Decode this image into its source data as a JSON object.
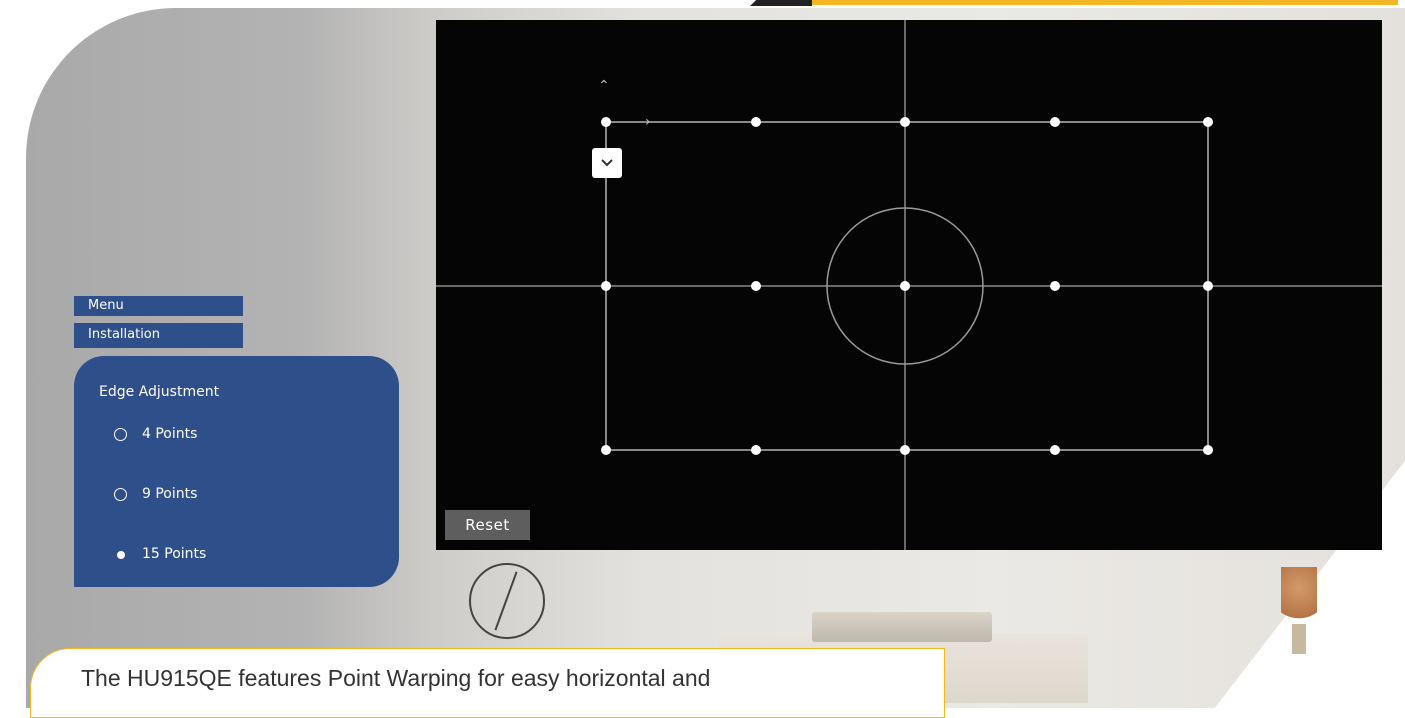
{
  "breadcrumb": {
    "menu": "Menu",
    "installation": "Installation"
  },
  "panel": {
    "title": "Edge Adjustment",
    "options": [
      {
        "label": "4 Points",
        "selected": false
      },
      {
        "label": "9 Points",
        "selected": false
      },
      {
        "label": "15 Points",
        "selected": true
      }
    ]
  },
  "screen": {
    "reset_label": "Reset",
    "grid_points": "15",
    "icons": [
      "chevron-up-icon",
      "chevron-right-icon",
      "chevron-down-icon"
    ]
  },
  "caption": {
    "text": "The HU915QE features Point Warping for easy horizontal and"
  },
  "colors": {
    "panel": "#2f4f8b",
    "accent": "#f5b625",
    "screen": "#050505"
  }
}
